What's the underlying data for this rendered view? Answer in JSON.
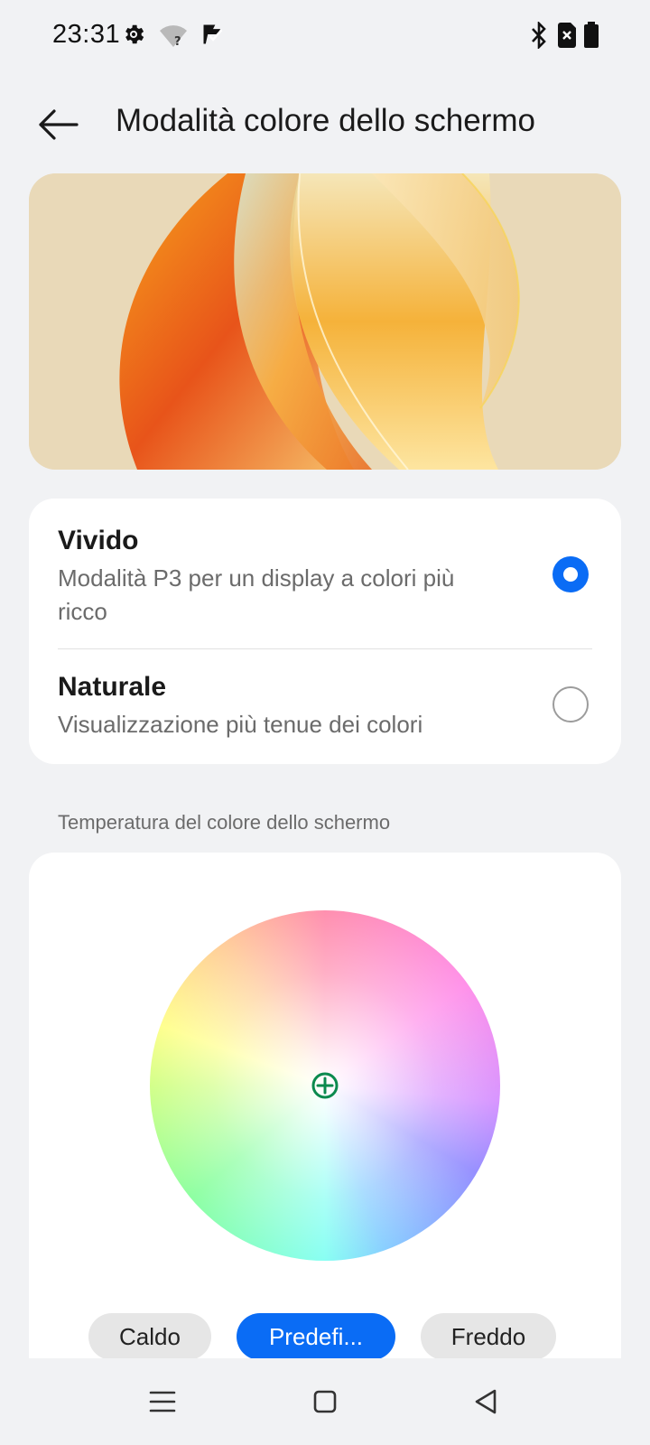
{
  "status_bar": {
    "time": "23:31",
    "left_icons": [
      "gear-icon",
      "wifi-unknown-icon",
      "checkmark-flag-icon"
    ],
    "right_icons": [
      "bluetooth-icon",
      "sim-none-icon",
      "battery-icon"
    ]
  },
  "header": {
    "title": "Modalità colore dello schermo",
    "back_icon": "arrow-left-icon"
  },
  "color_modes": [
    {
      "title": "Vivido",
      "description": "Modalità P3 per un display a colori più ricco",
      "selected": true
    },
    {
      "title": "Naturale",
      "description": "Visualizzazione più tenue dei colori",
      "selected": false
    }
  ],
  "temperature": {
    "label": "Temperatura del colore dello schermo",
    "presets": [
      {
        "label": "Caldo",
        "selected": false
      },
      {
        "label": "Predefi...",
        "selected": true
      },
      {
        "label": "Freddo",
        "selected": false
      }
    ]
  },
  "nav_bar": {
    "buttons": [
      "menu-icon",
      "home-icon",
      "back-triangle-icon"
    ]
  },
  "colors": {
    "accent": "#0a6cf5",
    "background": "#f1f2f4",
    "card": "#ffffff"
  }
}
